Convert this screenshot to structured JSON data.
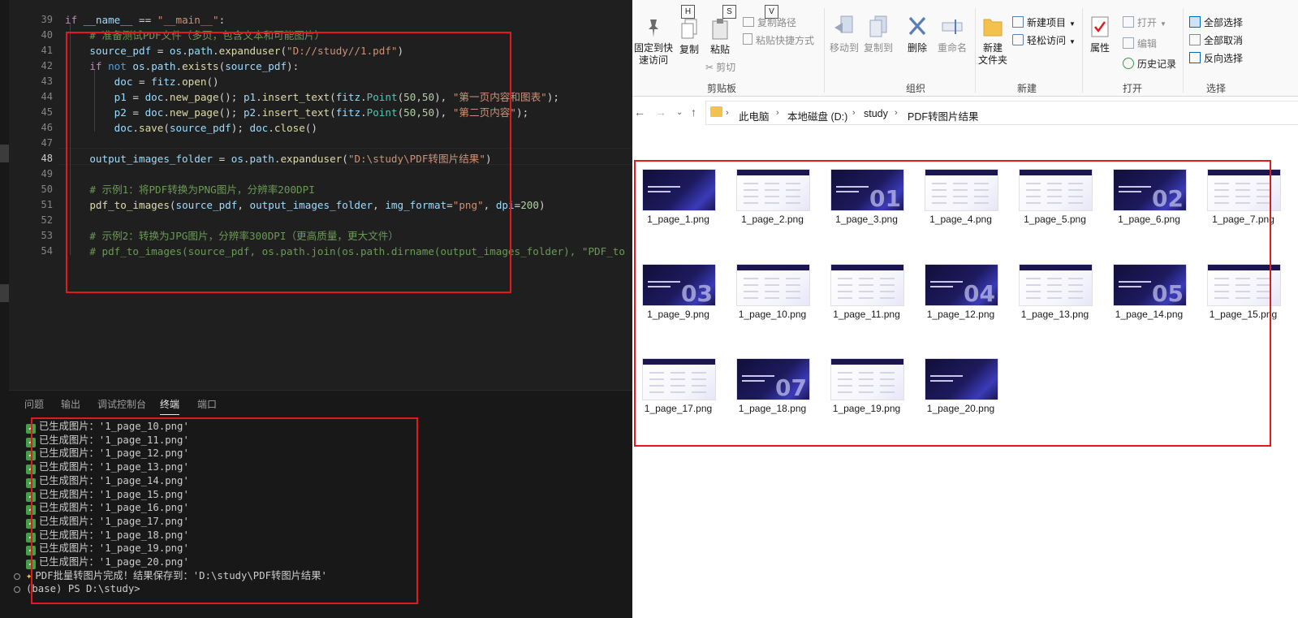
{
  "editor": {
    "lines": [
      {
        "n": "39",
        "tokens": [
          [
            "kw",
            "if "
          ],
          [
            "var",
            "__name__"
          ],
          [
            "op",
            " == "
          ],
          [
            "str",
            "\"__main__\""
          ],
          [
            "op",
            ":"
          ]
        ]
      },
      {
        "n": "40",
        "tokens": [
          [
            "cmt",
            "    # 准备测试PDF文件（多页，包含文本和可能图片）"
          ]
        ]
      },
      {
        "n": "41",
        "tokens": [
          [
            "var",
            "    source_pdf"
          ],
          [
            "op",
            " = "
          ],
          [
            "var",
            "os"
          ],
          [
            "op",
            "."
          ],
          [
            "var",
            "path"
          ],
          [
            "op",
            "."
          ],
          [
            "fn",
            "expanduser"
          ],
          [
            "op",
            "("
          ],
          [
            "str",
            "\"D://study//1.pdf\""
          ],
          [
            "op",
            ")"
          ]
        ]
      },
      {
        "n": "42",
        "tokens": [
          [
            "kw",
            "    if "
          ],
          [
            "kw2",
            "not "
          ],
          [
            "var",
            "os"
          ],
          [
            "op",
            "."
          ],
          [
            "var",
            "path"
          ],
          [
            "op",
            "."
          ],
          [
            "fn",
            "exists"
          ],
          [
            "op",
            "("
          ],
          [
            "var",
            "source_pdf"
          ],
          [
            "op",
            "):"
          ]
        ]
      },
      {
        "n": "43",
        "tokens": [
          [
            "var",
            "        doc"
          ],
          [
            "op",
            " = "
          ],
          [
            "var",
            "fitz"
          ],
          [
            "op",
            "."
          ],
          [
            "fn",
            "open"
          ],
          [
            "op",
            "()"
          ]
        ]
      },
      {
        "n": "44",
        "tokens": [
          [
            "var",
            "        p1"
          ],
          [
            "op",
            " = "
          ],
          [
            "var",
            "doc"
          ],
          [
            "op",
            "."
          ],
          [
            "fn",
            "new_page"
          ],
          [
            "op",
            "(); "
          ],
          [
            "var",
            "p1"
          ],
          [
            "op",
            "."
          ],
          [
            "fn",
            "insert_text"
          ],
          [
            "op",
            "("
          ],
          [
            "var",
            "fitz"
          ],
          [
            "op",
            "."
          ],
          [
            "cls",
            "Point"
          ],
          [
            "op",
            "("
          ],
          [
            "num",
            "50"
          ],
          [
            "op",
            ","
          ],
          [
            "num",
            "50"
          ],
          [
            "op",
            "), "
          ],
          [
            "str",
            "\"第一页内容和图表\""
          ],
          [
            "op",
            ");"
          ]
        ]
      },
      {
        "n": "45",
        "tokens": [
          [
            "var",
            "        p2"
          ],
          [
            "op",
            " = "
          ],
          [
            "var",
            "doc"
          ],
          [
            "op",
            "."
          ],
          [
            "fn",
            "new_page"
          ],
          [
            "op",
            "(); "
          ],
          [
            "var",
            "p2"
          ],
          [
            "op",
            "."
          ],
          [
            "fn",
            "insert_text"
          ],
          [
            "op",
            "("
          ],
          [
            "var",
            "fitz"
          ],
          [
            "op",
            "."
          ],
          [
            "cls",
            "Point"
          ],
          [
            "op",
            "("
          ],
          [
            "num",
            "50"
          ],
          [
            "op",
            ","
          ],
          [
            "num",
            "50"
          ],
          [
            "op",
            "), "
          ],
          [
            "str",
            "\"第二页内容\""
          ],
          [
            "op",
            ");"
          ]
        ]
      },
      {
        "n": "46",
        "tokens": [
          [
            "var",
            "        doc"
          ],
          [
            "op",
            "."
          ],
          [
            "fn",
            "save"
          ],
          [
            "op",
            "("
          ],
          [
            "var",
            "source_pdf"
          ],
          [
            "op",
            "); "
          ],
          [
            "var",
            "doc"
          ],
          [
            "op",
            "."
          ],
          [
            "fn",
            "close"
          ],
          [
            "op",
            "()"
          ]
        ]
      },
      {
        "n": "47",
        "tokens": []
      },
      {
        "n": "48",
        "tokens": [
          [
            "var",
            "    output_images_folder"
          ],
          [
            "op",
            " = "
          ],
          [
            "var",
            "os"
          ],
          [
            "op",
            "."
          ],
          [
            "var",
            "path"
          ],
          [
            "op",
            "."
          ],
          [
            "fn",
            "expanduser"
          ],
          [
            "op",
            "("
          ],
          [
            "str",
            "\"D:\\study\\PDF转图片结果\""
          ],
          [
            "op",
            ")"
          ]
        ]
      },
      {
        "n": "49",
        "tokens": []
      },
      {
        "n": "50",
        "tokens": [
          [
            "cmt",
            "    # 示例1：将PDF转换为PNG图片，分辨率200DPI"
          ]
        ]
      },
      {
        "n": "51",
        "tokens": [
          [
            "fn",
            "    pdf_to_images"
          ],
          [
            "op",
            "("
          ],
          [
            "var",
            "source_pdf"
          ],
          [
            "op",
            ", "
          ],
          [
            "var",
            "output_images_folder"
          ],
          [
            "op",
            ", "
          ],
          [
            "var",
            "img_format"
          ],
          [
            "op",
            "="
          ],
          [
            "str",
            "\"png\""
          ],
          [
            "op",
            ", "
          ],
          [
            "var",
            "dpi"
          ],
          [
            "op",
            "="
          ],
          [
            "num",
            "200"
          ],
          [
            "op",
            ")"
          ]
        ]
      },
      {
        "n": "52",
        "tokens": []
      },
      {
        "n": "53",
        "tokens": [
          [
            "cmt",
            "    # 示例2：转换为JPG图片，分辨率300DPI（更高质量，更大文件）"
          ]
        ]
      },
      {
        "n": "54",
        "tokens": [
          [
            "cmt",
            "    # pdf_to_images(source_pdf, os.path.join(os.path.dirname(output_images_folder), \"PDF_to"
          ]
        ]
      }
    ]
  },
  "panel": {
    "tabs": [
      "问题",
      "输出",
      "调试控制台",
      "终端",
      "端口"
    ],
    "active_tab": "终端",
    "generated_prefix": "已生成图片：",
    "generated": [
      "'1_page_10.png'",
      "'1_page_11.png'",
      "'1_page_12.png'",
      "'1_page_13.png'",
      "'1_page_14.png'",
      "'1_page_15.png'",
      "'1_page_16.png'",
      "'1_page_17.png'",
      "'1_page_18.png'",
      "'1_page_19.png'",
      "'1_page_20.png'"
    ],
    "done_line": "PDF批量转图片完成！结果保存到：'D:\\study\\PDF转图片结果'",
    "prompt_line": "(base) PS D:\\study>"
  },
  "ribbon": {
    "keytips": [
      "H",
      "S",
      "V"
    ],
    "pin_label": "固定到快\n速访问",
    "copy_label": "复制",
    "paste_label": "粘贴",
    "copy_path": "复制路径",
    "paste_shortcut": "粘贴快捷方式",
    "cut": "剪切",
    "clipboard_group": "剪贴板",
    "move_to": "移动到",
    "copy_to": "复制到",
    "delete": "删除",
    "rename": "重命名",
    "organize_group": "组织",
    "new_folder": "新建\n文件夹",
    "new_item": "新建项目",
    "easy_access": "轻松访问",
    "new_group": "新建",
    "properties": "属性",
    "open": "打开",
    "edit": "编辑",
    "history": "历史记录",
    "open_group": "打开",
    "select_all": "全部选择",
    "select_none": "全部取消",
    "invert_selection": "反向选择",
    "select_group": "选择"
  },
  "address": {
    "crumbs": [
      "此电脑",
      "本地磁盘 (D:)",
      "study",
      "PDF转图片结果"
    ]
  },
  "files": [
    {
      "name": "1_page_1.png",
      "style": "dark",
      "num": ""
    },
    {
      "name": "1_page_2.png",
      "style": "light",
      "num": ""
    },
    {
      "name": "1_page_3.png",
      "style": "dark",
      "num": "01"
    },
    {
      "name": "1_page_4.png",
      "style": "light",
      "num": ""
    },
    {
      "name": "1_page_5.png",
      "style": "light",
      "num": ""
    },
    {
      "name": "1_page_6.png",
      "style": "dark",
      "num": "02"
    },
    {
      "name": "1_page_7.png",
      "style": "light",
      "num": ""
    },
    {
      "name": "1_page_9.png",
      "style": "dark",
      "num": "03"
    },
    {
      "name": "1_page_10.png",
      "style": "light",
      "num": ""
    },
    {
      "name": "1_page_11.png",
      "style": "light",
      "num": ""
    },
    {
      "name": "1_page_12.png",
      "style": "dark",
      "num": "04"
    },
    {
      "name": "1_page_13.png",
      "style": "light",
      "num": ""
    },
    {
      "name": "1_page_14.png",
      "style": "dark",
      "num": "05"
    },
    {
      "name": "1_page_15.png",
      "style": "light",
      "num": ""
    },
    {
      "name": "1_page_17.png",
      "style": "light",
      "num": ""
    },
    {
      "name": "1_page_18.png",
      "style": "dark",
      "num": "07"
    },
    {
      "name": "1_page_19.png",
      "style": "light",
      "num": ""
    },
    {
      "name": "1_page_20.png",
      "style": "dark",
      "num": ""
    }
  ],
  "colors": {
    "highlight_box": "#e5191d",
    "folder": "#f2c14e",
    "accent": "#0067c0"
  }
}
